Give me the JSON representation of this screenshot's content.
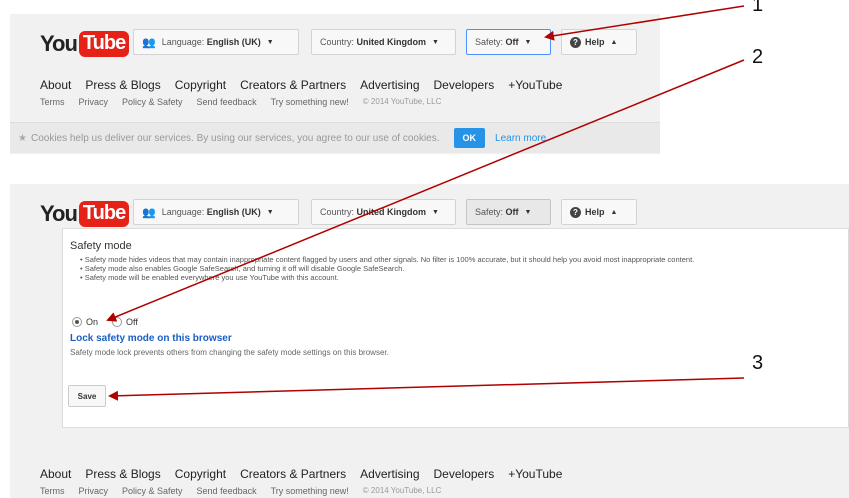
{
  "top": {
    "logo": {
      "you": "You",
      "tube": "Tube"
    },
    "language": {
      "label": "Language:",
      "value": "English (UK)"
    },
    "country": {
      "label": "Country:",
      "value": "United Kingdom"
    },
    "safety": {
      "label": "Safety:",
      "value": "Off"
    },
    "help": "Help",
    "nav": [
      "About",
      "Press & Blogs",
      "Copyright",
      "Creators & Partners",
      "Advertising",
      "Developers",
      "+YouTube"
    ],
    "subnav": [
      "Terms",
      "Privacy",
      "Policy & Safety",
      "Send feedback",
      "Try something new!"
    ],
    "copyright": "© 2014 YouTube, LLC",
    "cookie": {
      "text": "Cookies help us deliver our services. By using our services, you agree to our use of cookies.",
      "ok": "OK",
      "learn_more": "Learn more"
    }
  },
  "bottom": {
    "logo": {
      "you": "You",
      "tube": "Tube"
    },
    "language": {
      "label": "Language:",
      "value": "English (UK)"
    },
    "country": {
      "label": "Country:",
      "value": "United Kingdom"
    },
    "safety": {
      "label": "Safety:",
      "value": "Off"
    },
    "help": "Help",
    "safety_mode": {
      "title": "Safety mode",
      "bullets": [
        "Safety mode hides videos that may contain inappropriate content flagged by users and other signals. No filter is 100% accurate, but it should help you avoid most inappropriate content.",
        "Safety mode also enables Google SafeSearch, and turning it off will disable Google SafeSearch.",
        "Safety mode will be enabled everywhere you use YouTube with this account."
      ],
      "on_label": "On",
      "off_label": "Off",
      "selected": "On",
      "lock_link": "Lock safety mode on this browser",
      "lock_desc": "Safety mode lock prevents others from changing the safety mode settings on this browser.",
      "save": "Save"
    },
    "nav": [
      "About",
      "Press & Blogs",
      "Copyright",
      "Creators & Partners",
      "Advertising",
      "Developers",
      "+YouTube"
    ],
    "subnav": [
      "Terms",
      "Privacy",
      "Policy & Safety",
      "Send feedback",
      "Try something new!"
    ],
    "copyright": "© 2014 YouTube, LLC"
  },
  "annotations": {
    "n1": "1",
    "n2": "2",
    "n3": "3",
    "arrow_color": "#b00000"
  }
}
